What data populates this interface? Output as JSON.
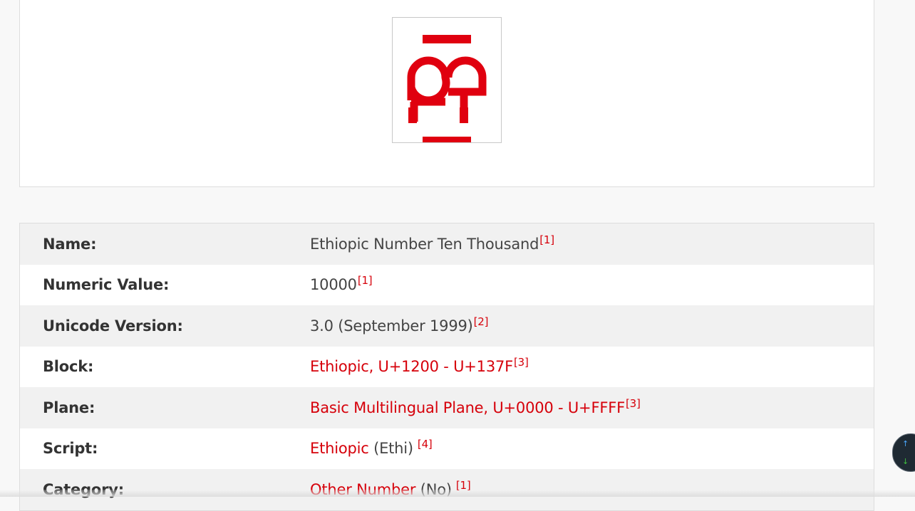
{
  "glyph": {
    "icon": "ethiopic-number-ten-thousand-glyph",
    "color": "#e0000f"
  },
  "colors": {
    "link": "#d6000a",
    "shaded_row": "#f1f1f1"
  },
  "properties": [
    {
      "label": "Name:",
      "value": "Ethiopic Number Ten Thousand",
      "ref": "[1]"
    },
    {
      "label": "Numeric Value:",
      "value": "10000",
      "ref": "[1]"
    },
    {
      "label": "Unicode Version:",
      "value": "3.0 (September 1999)",
      "ref": "[2]"
    },
    {
      "label": "Block:",
      "link": "Ethiopic, U+1200 - U+137F",
      "ref": "[3]"
    },
    {
      "label": "Plane:",
      "link": "Basic Multilingual Plane, U+0000 - U+FFFF",
      "ref": "[3]"
    },
    {
      "label": "Script:",
      "link": "Ethiopic",
      "suffix": " (Ethi)",
      "ref": "[4]"
    },
    {
      "label": "Category:",
      "link": "Other Number",
      "suffix": " (No)",
      "ref": "[1]"
    }
  ],
  "scroll_widget": {
    "up_icon": "arrow-up-icon",
    "down_icon": "arrow-down-icon"
  }
}
